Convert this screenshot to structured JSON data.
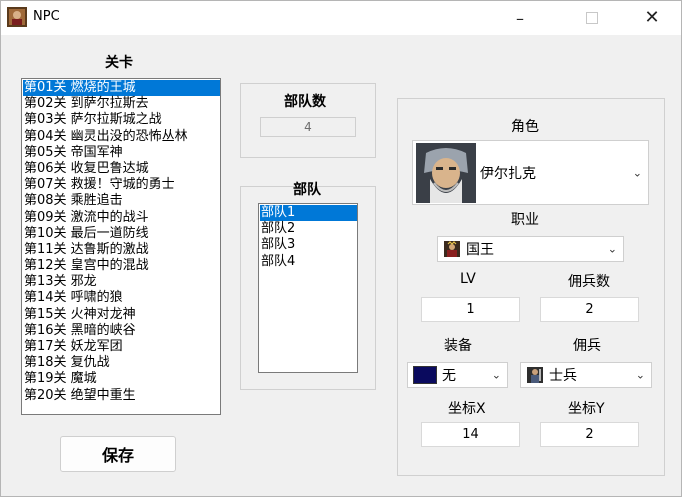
{
  "window": {
    "title": "NPC"
  },
  "stages": {
    "heading": "关卡",
    "items": [
      "第01关 燃烧的王城",
      "第02关 到萨尔拉斯去",
      "第03关 萨尔拉斯城之战",
      "第04关 幽灵出没的恐怖丛林",
      "第05关 帝国军神",
      "第06关 收复巴鲁达城",
      "第07关 救援！守城的勇士",
      "第08关 乘胜追击",
      "第09关 激流中的战斗",
      "第10关 最后一道防线",
      "第11关 达鲁斯的激战",
      "第12关 皇宫中的混战",
      "第13关 邪龙",
      "第14关 呼啸的狼",
      "第15关 火神对龙神",
      "第16关 黑暗的峡谷",
      "第17关 妖龙军团",
      "第18关 复仇战",
      "第19关 魔城",
      "第20关 绝望中重生"
    ],
    "selected_index": 0
  },
  "save_button": "保存",
  "troop_count": {
    "label": "部队数",
    "value": "4"
  },
  "troops": {
    "label": "部队",
    "items": [
      "部队1",
      "部队2",
      "部队3",
      "部队4"
    ],
    "selected_index": 0
  },
  "character": {
    "label": "角色",
    "value": "伊尔扎克",
    "icon": "old-wizard-portrait"
  },
  "job": {
    "label": "职业",
    "value": "国王",
    "icon": "king-icon"
  },
  "lv": {
    "label": "LV",
    "value": "1"
  },
  "mercenary_count": {
    "label": "佣兵数",
    "value": "2"
  },
  "equipment": {
    "label": "装备",
    "value": "无",
    "swatch_color": "#0a0a5e"
  },
  "mercenary": {
    "label": "佣兵",
    "value": "士兵",
    "icon": "soldier-icon"
  },
  "coord_x": {
    "label": "坐标X",
    "value": "14"
  },
  "coord_y": {
    "label": "坐标Y",
    "value": "2"
  },
  "colors": {
    "selection": "#0078d7",
    "window_bg": "#f0f0f0"
  }
}
